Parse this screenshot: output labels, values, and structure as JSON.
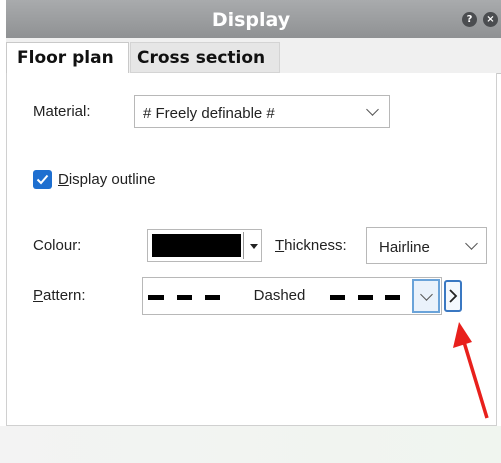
{
  "window": {
    "title": "Display",
    "help_icon": "question-icon",
    "close_icon": "close-icon"
  },
  "tabs": [
    {
      "label": "Floor plan",
      "active": true
    },
    {
      "label": "Cross section",
      "active": false
    }
  ],
  "material": {
    "label": "Material:",
    "value": "# Freely definable #"
  },
  "display_outline": {
    "label": "Display outline",
    "checked": true
  },
  "colour": {
    "label": "Colour:",
    "value_color": "#000000"
  },
  "thickness": {
    "label": "Thickness:",
    "value": "Hairline"
  },
  "pattern": {
    "label": "Pattern:",
    "value": "Dashed"
  },
  "annotation": {
    "color": "#e8201c"
  }
}
